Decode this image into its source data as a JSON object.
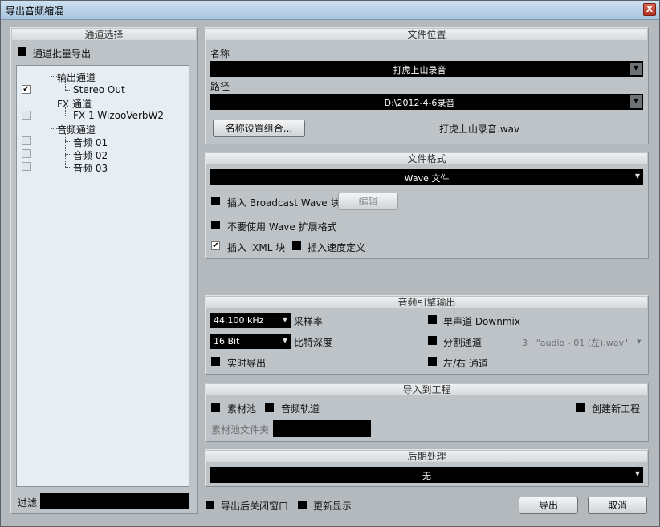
{
  "window": {
    "title": "导出音频缩混",
    "close_glyph": "X"
  },
  "channel_panel": {
    "header": "通道选择",
    "batch_export_label": "通道批量导出",
    "tree": {
      "output_group": "输出通道",
      "output_items": [
        "Stereo Out"
      ],
      "fx_group": "FX 通道",
      "fx_items": [
        "FX 1-WizooVerbW2"
      ],
      "audio_group": "音频通道",
      "audio_items": [
        "音频 01",
        "音频 02",
        "音频 03"
      ],
      "check_glyph": "✔"
    },
    "filter_label": "过滤",
    "filter_value": ""
  },
  "file_location": {
    "header": "文件位置",
    "name_label": "名称",
    "name_value": "打虎上山录音",
    "path_label": "路径",
    "path_value": "D:\\2012-4-6录音",
    "naming_button": "名称设置组合...",
    "filename_preview": "打虎上山录音.wav"
  },
  "file_format": {
    "header": "文件格式",
    "format_value": "Wave 文件",
    "insert_broadcast": "插入 Broadcast Wave 块",
    "edit_button": "编辑",
    "no_wave_ext": "不要使用 Wave 扩展格式",
    "insert_ixml": "插入 iXML 块",
    "insert_tempo": "插入速度定义"
  },
  "engine_output": {
    "header": "音频引擎输出",
    "sample_rate_value": "44.100 kHz",
    "sample_rate_label": "采样率",
    "bit_depth_value": "16 Bit",
    "bit_depth_label": "比特深度",
    "realtime_export": "实时导出",
    "mono_downmix": "单声道 Downmix",
    "split_channels": "分割通道",
    "split_channels_value": "3 : \"audio - 01 (左).wav\"",
    "lr_channels": "左/右 通道"
  },
  "import_project": {
    "header": "导入到工程",
    "pool": "素材池",
    "audio_track": "音频轨道",
    "new_project": "创建新工程",
    "pool_folder_label": "素材池文件夹",
    "pool_folder_value": ""
  },
  "post_process": {
    "header": "后期处理",
    "value": "无"
  },
  "footer": {
    "close_after_export": "导出后关闭窗口",
    "update_display": "更新显示",
    "export_button": "导出",
    "cancel_button": "取消"
  },
  "icons": {
    "dropdown_glyph": "▼"
  }
}
